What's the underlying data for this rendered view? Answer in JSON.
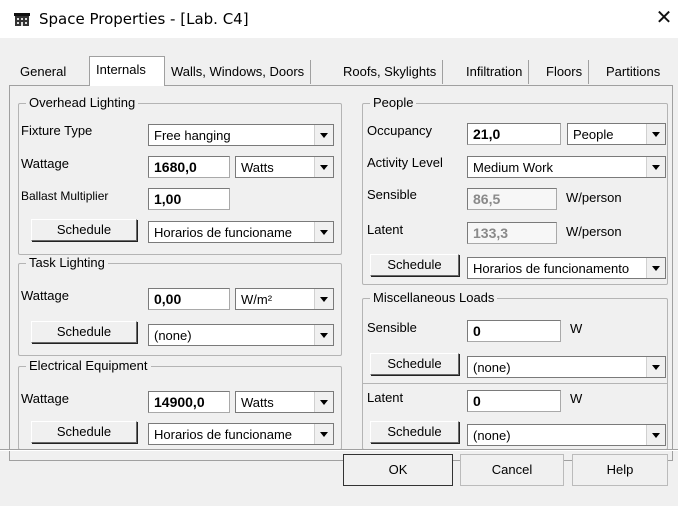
{
  "window": {
    "title": "Space Properties - [Lab. C4]",
    "close_glyph": "✕"
  },
  "tabs": [
    {
      "label": "General"
    },
    {
      "label": "Internals"
    },
    {
      "label": "Walls, Windows, Doors"
    },
    {
      "label": "Roofs, Skylights"
    },
    {
      "label": "Infiltration"
    },
    {
      "label": "Floors"
    },
    {
      "label": "Partitions"
    }
  ],
  "overhead_lighting": {
    "title": "Overhead Lighting",
    "fixture_type_label": "Fixture Type",
    "fixture_type_value": "Free hanging",
    "wattage_label": "Wattage",
    "wattage_value": "1680,0",
    "wattage_unit": "Watts",
    "ballast_label": "Ballast Multiplier",
    "ballast_value": "1,00",
    "schedule_button": "Schedule",
    "schedule_value": "Horarios de funcioname"
  },
  "task_lighting": {
    "title": "Task Lighting",
    "wattage_label": "Wattage",
    "wattage_value": "0,00",
    "wattage_unit": "W/m²",
    "schedule_button": "Schedule",
    "schedule_value": "(none)"
  },
  "electrical_equipment": {
    "title": "Electrical Equipment",
    "wattage_label": "Wattage",
    "wattage_value": "14900,0",
    "wattage_unit": "Watts",
    "schedule_button": "Schedule",
    "schedule_value": "Horarios de funcioname"
  },
  "people": {
    "title": "People",
    "occupancy_label": "Occupancy",
    "occupancy_value": "21,0",
    "occupancy_unit": "People",
    "activity_label": "Activity Level",
    "activity_value": "Medium Work",
    "sensible_label": "Sensible",
    "sensible_value": "86,5",
    "sensible_unit": "W/person",
    "latent_label": "Latent",
    "latent_value": "133,3",
    "latent_unit": "W/person",
    "schedule_button": "Schedule",
    "schedule_value": "Horarios de funcionamento"
  },
  "misc_loads": {
    "title": "Miscellaneous Loads",
    "sensible_label": "Sensible",
    "sensible_value": "0",
    "sensible_unit": "W",
    "sensible_schedule_button": "Schedule",
    "sensible_schedule_value": "(none)",
    "latent_label": "Latent",
    "latent_value": "0",
    "latent_unit": "W",
    "latent_schedule_button": "Schedule",
    "latent_schedule_value": "(none)"
  },
  "buttons": {
    "ok": "OK",
    "cancel": "Cancel",
    "help": "Help"
  },
  "icons": {
    "app": "building-icon",
    "close": "close-icon",
    "dropdown": "chevron-down-icon"
  }
}
